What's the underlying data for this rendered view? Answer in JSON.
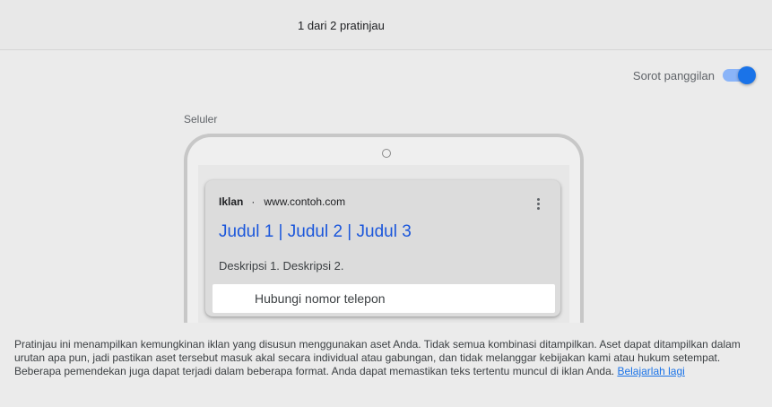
{
  "header": {
    "preview_counter": "1 dari 2 pratinjau"
  },
  "highlight_toggle": {
    "label": "Sorot panggilan",
    "on": true,
    "accent_color": "#1a73e8"
  },
  "device": {
    "label": "Seluler"
  },
  "ad": {
    "badge": "Iklan",
    "separator": "·",
    "display_url": "www.contoh.com",
    "headline": "Judul 1 | Judul 2 | Judul 3",
    "description": "Deskripsi 1. Deskripsi 2.",
    "call_extension": "Hubungi nomor telepon",
    "more_icon": "more-vert-icon"
  },
  "footer": {
    "disclaimer": "Pratinjau ini menampilkan kemungkinan iklan yang disusun menggunakan aset Anda. Tidak semua kombinasi ditampilkan. Aset dapat ditampilkan dalam urutan apa pun, jadi pastikan aset tersebut masuk akal secara individual atau gabungan, dan tidak melanggar kebijakan kami atau hukum setempat. Beberapa pemendekan juga dapat terjadi dalam beberapa format. Anda dapat memastikan teks tertentu muncul di iklan Anda.",
    "learn_more": "Belajarlah lagi"
  }
}
